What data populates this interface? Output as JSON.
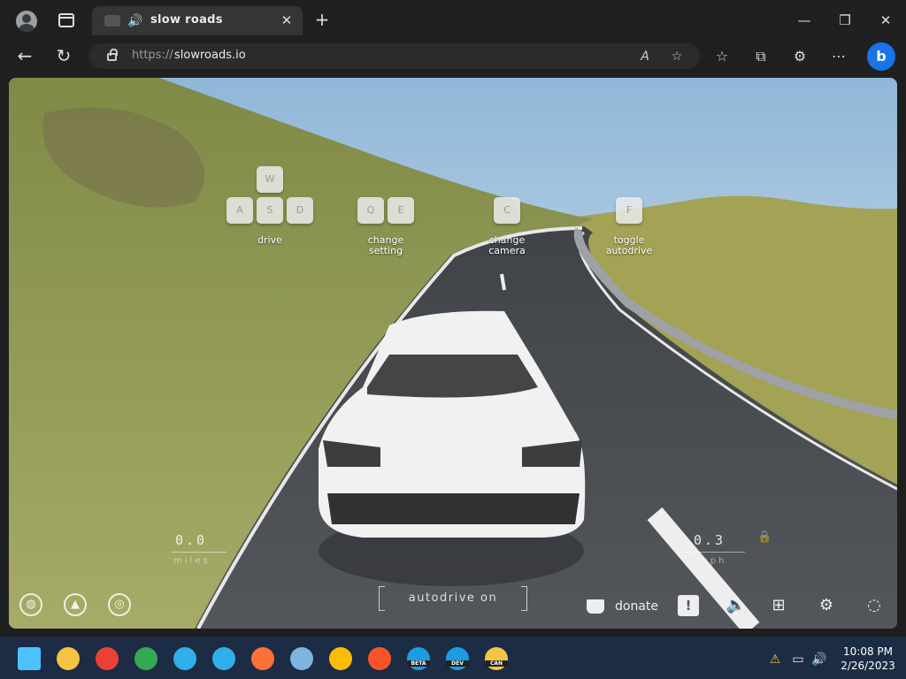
{
  "browser": {
    "tab_title": "slow roads",
    "url_protocol": "https://",
    "url_host": "slowroads.io",
    "icons": {
      "profile": "profile-icon",
      "tab_actions": "tab-actions-icon",
      "tab_audio": "speaker-icon",
      "tab_close": "close-icon",
      "new_tab": "plus-icon",
      "minimize": "minimize-icon",
      "restore": "restore-icon",
      "close_window": "close-icon",
      "back": "back-arrow-icon",
      "refresh": "refresh-icon",
      "lock": "lock-icon",
      "read_aloud": "read-aloud-icon",
      "favorite": "star-plus-icon",
      "favorites": "favorites-icon",
      "collections": "collections-icon",
      "extensions": "extensions-icon",
      "more": "more-icon",
      "bing": "bing-icon"
    },
    "glyphs": {
      "tab_audio": "🔊",
      "tab_close": "✕",
      "new_tab": "+",
      "minimize": "—",
      "restore": "❐",
      "close_window": "✕",
      "back": "←",
      "refresh": "↻",
      "read_aloud": "A",
      "favorite": "☆",
      "favorites": "☆",
      "collections": "⧉",
      "extensions": "⚙",
      "more": "⋯",
      "bing": "b"
    }
  },
  "game": {
    "controls": [
      {
        "keys": [
          "W",
          "A",
          "S",
          "D"
        ],
        "label_line1": "drive",
        "label_line2": ""
      },
      {
        "keys": [
          "Q",
          "E"
        ],
        "label_line1": "change",
        "label_line2": "setting"
      },
      {
        "keys": [
          "C"
        ],
        "label_line1": "change",
        "label_line2": "camera"
      },
      {
        "keys": [
          "F"
        ],
        "label_line1": "toggle",
        "label_line2": "autodrive"
      }
    ],
    "distance": {
      "value": "0.0",
      "unit": "miles"
    },
    "speed": {
      "value": "0.3",
      "unit": "mph"
    },
    "status": "autodrive on",
    "donate_label": "donate",
    "icons": {
      "globe": "globe-icon",
      "landscape": "landscape-icon",
      "steering": "steering-wheel-icon",
      "donate": "coffee-cup-icon",
      "feedback": "feedback-icon",
      "sound": "speaker-icon",
      "network": "network-icon",
      "settings": "gear-icon",
      "fingerprint": "fingerprint-icon",
      "lock": "lock-icon"
    },
    "glyphs": {
      "globe": "◍",
      "landscape": "▲",
      "steering": "◎",
      "feedback": "!",
      "sound": "🔈",
      "network": "⊞",
      "settings": "⚙",
      "fingerprint": "◌",
      "lock": "🔒"
    }
  },
  "taskbar": {
    "apps": [
      {
        "name": "start-icon",
        "color": "#4cc2ff"
      },
      {
        "name": "file-explorer-icon",
        "color": "#f6c343"
      },
      {
        "name": "chrome-icon",
        "color": "#e94235"
      },
      {
        "name": "chrome-icon",
        "color": "#34a853"
      },
      {
        "name": "edge-icon",
        "color": "#2fb0e8"
      },
      {
        "name": "edge-icon",
        "color": "#2fb0e8"
      },
      {
        "name": "firefox-icon",
        "color": "#ff7139"
      },
      {
        "name": "photos-icon",
        "color": "#7fb3e0"
      },
      {
        "name": "chrome-icon",
        "color": "#fbbc04"
      },
      {
        "name": "brave-icon",
        "color": "#fb542b"
      },
      {
        "name": "edge-beta-icon",
        "color": "#1b9de2",
        "label": "BETA"
      },
      {
        "name": "edge-dev-icon",
        "color": "#1b9de2",
        "label": "DEV"
      },
      {
        "name": "edge-canary-icon",
        "color": "#f6c343",
        "label": "CAN"
      }
    ],
    "tray": {
      "time": "10:08 PM",
      "date": "2/26/2023",
      "icons": [
        "security-warning-icon",
        "network-icon",
        "volume-icon"
      ]
    }
  }
}
